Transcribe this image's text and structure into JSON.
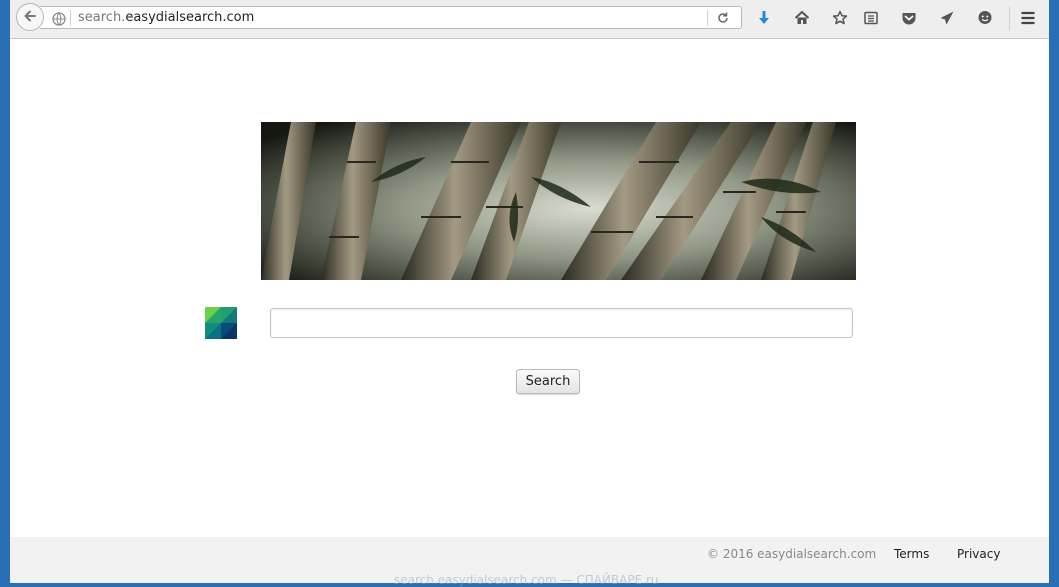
{
  "browser": {
    "url_prefix": "search.",
    "url_domain": "easydialsearch.com",
    "icons": [
      "back-arrow-icon",
      "globe-icon",
      "reload-icon",
      "download-icon",
      "home-icon",
      "bookmark-star-icon",
      "reading-list-icon",
      "pocket-icon",
      "send-tab-icon",
      "chat-icon",
      "hamburger-menu-icon"
    ]
  },
  "page": {
    "search_placeholder": "",
    "search_value": "",
    "search_button": "Search"
  },
  "footer": {
    "copyright": "© 2016 easydialsearch.com",
    "terms": "Terms",
    "privacy": "Privacy"
  },
  "watermark": "search.easydialsearch.com — СПАЙВАРЕ.ru",
  "colors": {
    "desktop": "#2a6fb5",
    "toolbar": "#eeeeee",
    "download_accent": "#1e8ae6",
    "footer_bg": "#f2f2f2"
  }
}
